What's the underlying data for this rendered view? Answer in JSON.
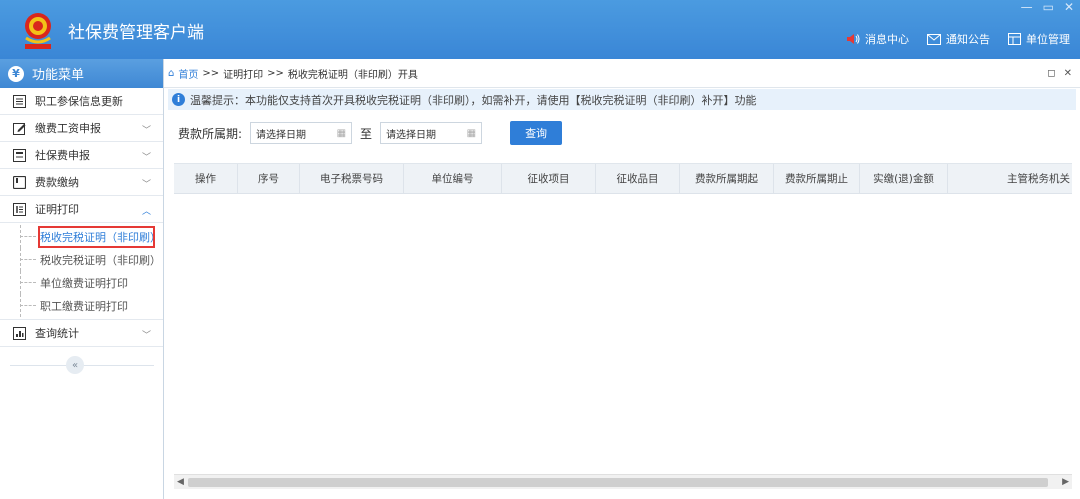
{
  "app": {
    "title": "社保费管理客户端",
    "window_controls": [
      "—",
      "▭",
      "✕"
    ],
    "top_actions": [
      {
        "label": "消息中心",
        "icon": "speaker-icon"
      },
      {
        "label": "通知公告",
        "icon": "mail-icon"
      },
      {
        "label": "单位管理",
        "icon": "building-icon"
      }
    ]
  },
  "sidebar": {
    "header": "功能菜单",
    "items": [
      {
        "label": "职工参保信息更新",
        "icon": "list-icon",
        "has_chevron": false
      },
      {
        "label": "缴费工资申报",
        "icon": "edit-icon",
        "has_chevron": true
      },
      {
        "label": "社保费申报",
        "icon": "doc-icon",
        "has_chevron": true
      },
      {
        "label": "费款缴纳",
        "icon": "card-icon",
        "has_chevron": true
      },
      {
        "label": "证明打印",
        "icon": "print-icon",
        "has_chevron": true,
        "expanded": true
      }
    ],
    "subitems": [
      {
        "label": "税收完税证明（非印刷）",
        "active": true
      },
      {
        "label": "税收完税证明（非印刷）",
        "active": false
      },
      {
        "label": "单位缴费证明打印",
        "active": false
      },
      {
        "label": "职工缴费证明打印",
        "active": false
      }
    ],
    "last_item": {
      "label": "查询统计",
      "icon": "chart-icon"
    },
    "collapse_glyph": "«"
  },
  "breadcrumb": {
    "home": "首页",
    "sep": ">>",
    "level1": "证明打印",
    "level2": "税收完税证明（非印刷）开具"
  },
  "notice": "温馨提示：本功能仅支持首次开具税收完税证明（非印刷），如需补开，请使用【税收完税证明（非印刷）补开】功能",
  "filter": {
    "label": "费款所属期:",
    "to_label": "至",
    "start_placeholder": "请选择日期",
    "end_placeholder": "请选择日期",
    "query_button": "查询"
  },
  "grid": {
    "columns": [
      "操作",
      "序号",
      "电子税票号码",
      "单位编号",
      "征收项目",
      "征收品目",
      "费款所属期起",
      "费款所属期止",
      "实缴(退)金额",
      "主管税务机关"
    ],
    "rows": []
  },
  "colors": {
    "title_bar": "#3a86d6",
    "accent": "#2f7ed8",
    "highlight_box": "#e53935"
  }
}
